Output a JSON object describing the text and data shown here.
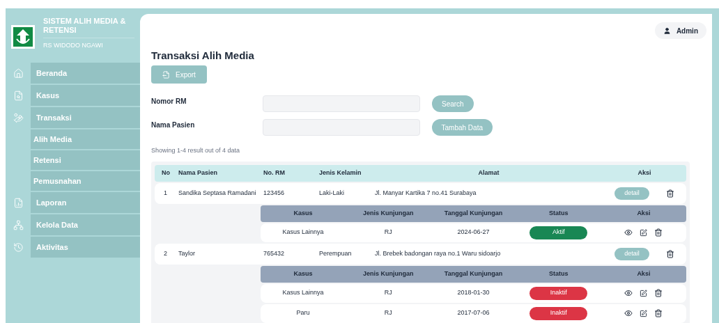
{
  "sidebar": {
    "title": "SISTEM ALIH MEDIA & RETENSI",
    "subtitle": "RS WIDODO NGAWI",
    "items": [
      {
        "label": "Beranda"
      },
      {
        "label": "Kasus"
      },
      {
        "label": "Transaksi",
        "children": [
          {
            "label": "Alih Media"
          },
          {
            "label": "Retensi"
          },
          {
            "label": "Pemusnahan"
          }
        ]
      },
      {
        "label": "Laporan"
      },
      {
        "label": "Kelola Data"
      },
      {
        "label": "Aktivitas"
      }
    ]
  },
  "user": {
    "label": "Admin"
  },
  "page_title": "Transaksi Alih Media",
  "export_button": "Export",
  "form": [
    {
      "label": "Nomor RM",
      "button": "Search"
    },
    {
      "label": "Nama Pasien",
      "button": "Tambah Data"
    }
  ],
  "summary": "Showing 1-4 result out of 4 data",
  "table": {
    "columns": [
      "No",
      "Nama Pasien",
      "No. RM",
      "Jenis Kelamin",
      "Alamat",
      "Aksi"
    ],
    "rows": [
      {
        "no": "1",
        "name": "Sandika Septasa Ramadani",
        "rm": "123456",
        "gender": "Laki-Laki",
        "address": "Jl. Manyar Kartika 7 no.41 Surabaya",
        "detail_button": "detail",
        "sub_columns": [
          "Kasus",
          "Jenis Kunjungan",
          "Tanggal Kunjungan",
          "Status",
          "Aksi"
        ],
        "visits": [
          {
            "case": "Kasus Lainnya",
            "type": "RJ",
            "date": "2024-06-27",
            "status": "Aktif",
            "active": true
          }
        ]
      },
      {
        "no": "2",
        "name": "Taylor",
        "rm": "765432",
        "gender": "Perempuan",
        "address": "Jl. Brebek badongan raya no.1 Waru sidoarjo",
        "detail_button": "detail",
        "sub_columns": [
          "Kasus",
          "Jenis Kunjungan",
          "Tanggal Kunjungan",
          "Status",
          "Aksi"
        ],
        "visits": [
          {
            "case": "Kasus Lainnya",
            "type": "RJ",
            "date": "2018-01-30",
            "status": "Inaktif",
            "active": false
          },
          {
            "case": "Paru",
            "type": "RJ",
            "date": "2017-07-06",
            "status": "Inaktif",
            "active": false
          }
        ]
      }
    ]
  }
}
